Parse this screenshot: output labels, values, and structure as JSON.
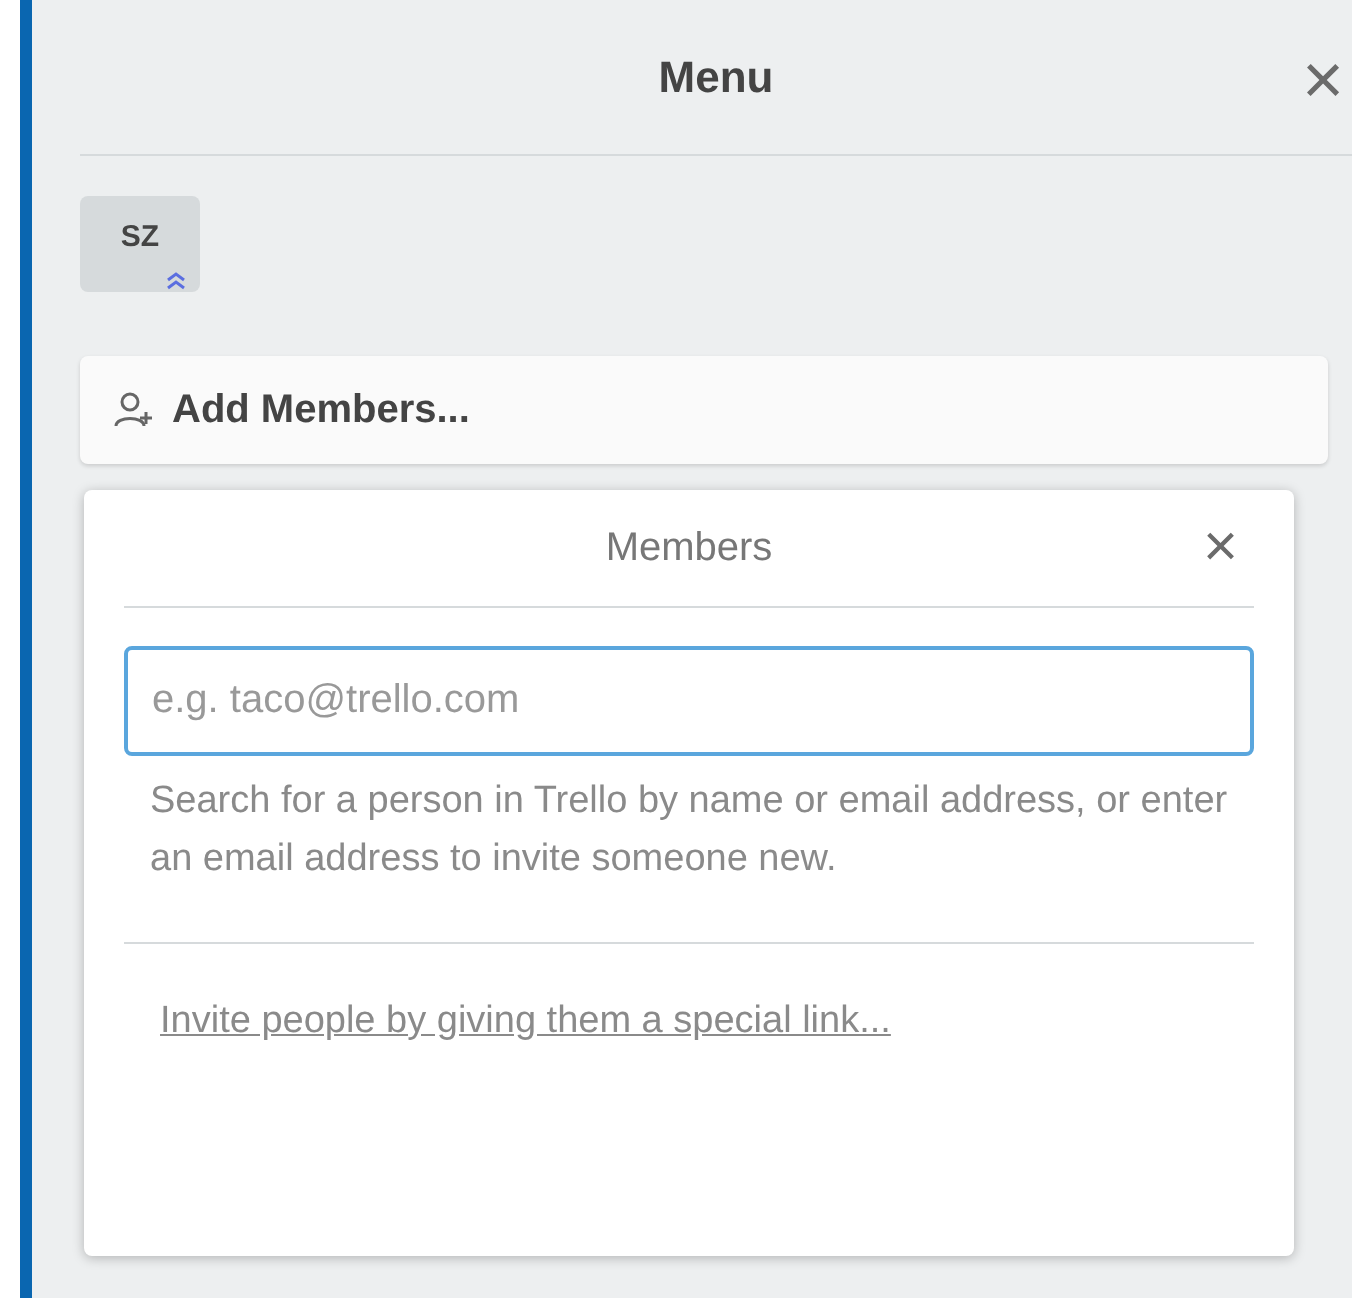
{
  "menu": {
    "title": "Menu",
    "close": "×"
  },
  "members": [
    {
      "initials": "SZ",
      "admin": true
    }
  ],
  "add_members_button": {
    "label": "Add Members..."
  },
  "popup": {
    "title": "Members",
    "close": "×",
    "search": {
      "placeholder": "e.g. taco@trello.com"
    },
    "help_text": "Search for a person in Trello by name or email address, or enter an email address to invite someone new.",
    "invite_link": "Invite people by giving them a special link..."
  }
}
